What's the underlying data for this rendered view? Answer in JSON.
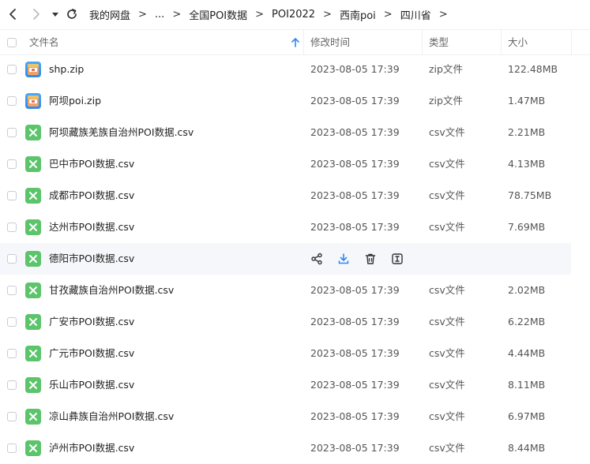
{
  "toolbar": {
    "breadcrumbs": [
      "我的网盘",
      "...",
      "全国POI数据",
      "POI2022",
      "西南poi",
      "四川省"
    ]
  },
  "columns": {
    "name": "文件名",
    "modified": "修改时间",
    "type": "类型",
    "size": "大小"
  },
  "files": [
    {
      "name": "shp.zip",
      "icon": "zip-icon",
      "modified": "2023-08-05 17:39",
      "type": "zip文件",
      "size": "122.48MB"
    },
    {
      "name": "阿坝poi.zip",
      "icon": "zip-icon",
      "modified": "2023-08-05 17:39",
      "type": "zip文件",
      "size": "1.47MB"
    },
    {
      "name": "阿坝藏族羌族自治州POI数据.csv",
      "icon": "csv-icon",
      "modified": "2023-08-05 17:39",
      "type": "csv文件",
      "size": "2.21MB"
    },
    {
      "name": "巴中市POI数据.csv",
      "icon": "csv-icon",
      "modified": "2023-08-05 17:39",
      "type": "csv文件",
      "size": "4.13MB"
    },
    {
      "name": "成都市POI数据.csv",
      "icon": "csv-icon",
      "modified": "2023-08-05 17:39",
      "type": "csv文件",
      "size": "78.75MB"
    },
    {
      "name": "达州市POI数据.csv",
      "icon": "csv-icon",
      "modified": "2023-08-05 17:39",
      "type": "csv文件",
      "size": "7.69MB"
    },
    {
      "name": "德阳市POI数据.csv",
      "icon": "csv-icon",
      "hover": true
    },
    {
      "name": "甘孜藏族自治州POI数据.csv",
      "icon": "csv-icon",
      "modified": "2023-08-05 17:39",
      "type": "csv文件",
      "size": "2.02MB"
    },
    {
      "name": "广安市POI数据.csv",
      "icon": "csv-icon",
      "modified": "2023-08-05 17:39",
      "type": "csv文件",
      "size": "6.22MB"
    },
    {
      "name": "广元市POI数据.csv",
      "icon": "csv-icon",
      "modified": "2023-08-05 17:39",
      "type": "csv文件",
      "size": "4.44MB"
    },
    {
      "name": "乐山市POI数据.csv",
      "icon": "csv-icon",
      "modified": "2023-08-05 17:39",
      "type": "csv文件",
      "size": "8.11MB"
    },
    {
      "name": "凉山彝族自治州POI数据.csv",
      "icon": "csv-icon",
      "modified": "2023-08-05 17:39",
      "type": "csv文件",
      "size": "6.97MB"
    },
    {
      "name": "泸州市POI数据.csv",
      "icon": "csv-icon",
      "modified": "2023-08-05 17:39",
      "type": "csv文件",
      "size": "8.44MB"
    }
  ],
  "row_actions": [
    "share-icon",
    "download-icon",
    "delete-icon",
    "rename-icon"
  ],
  "colors": {
    "accent": "#2f89ee",
    "csv": "#5cc46b",
    "zip": "#3d9cf5"
  }
}
